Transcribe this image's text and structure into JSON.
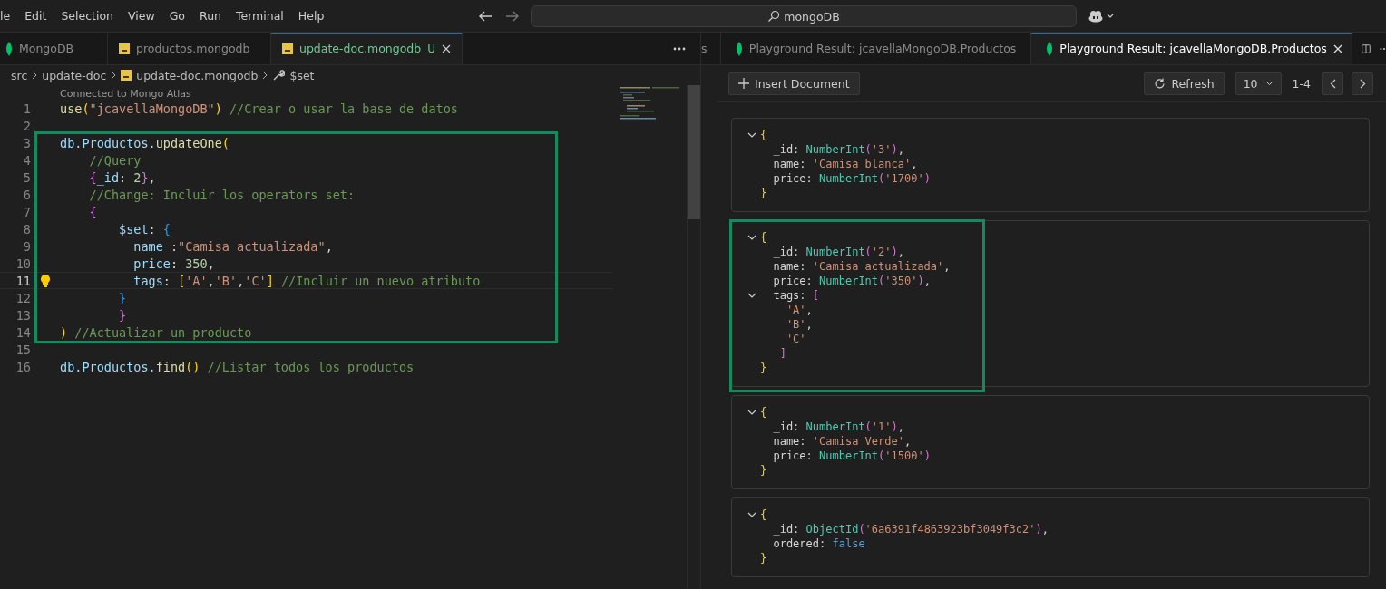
{
  "menu": [
    "le",
    "Edit",
    "Selection",
    "View",
    "Go",
    "Run",
    "Terminal",
    "Help"
  ],
  "search": {
    "value": "mongoDB"
  },
  "editor": {
    "tabs": [
      {
        "label": "MongoDB",
        "kind": "mongo",
        "selected": false
      },
      {
        "label": "productos.mongodb",
        "kind": "js",
        "selected": false
      },
      {
        "label": "update-doc.mongodb",
        "kind": "js",
        "selected": true,
        "badge": "U"
      }
    ],
    "breadcrumb": [
      {
        "label": "src",
        "kind": "folder"
      },
      {
        "label": "update-doc",
        "kind": "folder"
      },
      {
        "label": "update-doc.mongodb",
        "kind": "file"
      },
      {
        "label": "$set",
        "kind": "symbol"
      }
    ],
    "codelens": "Connected to Mongo Atlas",
    "segments": [
      {
        "highlighted": false,
        "lines": [
          {
            "number": "1",
            "current": false,
            "tokens": [
              {
                "text": "use",
                "kind": "fn"
              },
              {
                "text": "(",
                "kind": "b1"
              },
              {
                "text": "\"jcavellaMongoDB\"",
                "kind": "str"
              },
              {
                "text": ")",
                "kind": "b1"
              },
              {
                "text": " //Crear o usar la base de datos",
                "kind": "comment"
              }
            ]
          },
          {
            "number": "2",
            "current": false
          }
        ]
      },
      {
        "highlighted": true,
        "lines": [
          {
            "number": "3",
            "current": false,
            "tokens": [
              {
                "text": "db.Productos.",
                "kind": "var"
              },
              {
                "text": "updateOne",
                "kind": "fn"
              },
              {
                "text": "(",
                "kind": "b1"
              }
            ]
          },
          {
            "number": "4",
            "current": false,
            "tokens": [
              {
                "text": "    //Query",
                "kind": "comment"
              }
            ]
          },
          {
            "number": "5",
            "current": false,
            "tokens": [
              {
                "text": "    {",
                "kind": "b2"
              },
              {
                "text": "_id",
                "kind": "var"
              },
              {
                "text": ": ",
                "kind": "plain"
              },
              {
                "text": "2",
                "kind": "num"
              },
              {
                "text": "}",
                "kind": "b2"
              },
              {
                "text": ",",
                "kind": "plain"
              }
            ]
          },
          {
            "number": "6",
            "current": false,
            "tokens": [
              {
                "text": "    //Change: Incluir los operators set:",
                "kind": "comment"
              }
            ]
          },
          {
            "number": "7",
            "current": false,
            "tokens": [
              {
                "text": "    {",
                "kind": "b2"
              }
            ]
          },
          {
            "number": "8",
            "current": false,
            "tokens": [
              {
                "text": "        $set",
                "kind": "var"
              },
              {
                "text": ": ",
                "kind": "plain"
              },
              {
                "text": "{",
                "kind": "b3"
              }
            ]
          },
          {
            "number": "9",
            "current": false,
            "tokens": [
              {
                "text": "          name",
                "kind": "var"
              },
              {
                "text": " :",
                "kind": "plain"
              },
              {
                "text": "\"Camisa actualizada\"",
                "kind": "str"
              },
              {
                "text": ",",
                "kind": "plain"
              }
            ]
          },
          {
            "number": "10",
            "current": false,
            "tokens": [
              {
                "text": "          price",
                "kind": "var"
              },
              {
                "text": ": ",
                "kind": "plain"
              },
              {
                "text": "350",
                "kind": "num"
              },
              {
                "text": ",",
                "kind": "plain"
              }
            ]
          },
          {
            "number": "11",
            "current": true,
            "tokens": [
              {
                "text": "          tags",
                "kind": "var"
              },
              {
                "text": ": ",
                "kind": "plain"
              },
              {
                "text": "[",
                "kind": "b1"
              },
              {
                "text": "'A'",
                "kind": "str"
              },
              {
                "text": ",",
                "kind": "plain"
              },
              {
                "text": "'B'",
                "kind": "str"
              },
              {
                "text": ",",
                "kind": "plain"
              },
              {
                "text": "'C'",
                "kind": "str"
              },
              {
                "text": "]",
                "kind": "b1"
              },
              {
                "text": " //Incluir un nuevo atributo",
                "kind": "comment"
              }
            ]
          },
          {
            "number": "12",
            "current": false,
            "tokens": [
              {
                "text": "        }",
                "kind": "b3"
              }
            ]
          },
          {
            "number": "13",
            "current": false,
            "tokens": [
              {
                "text": "        }",
                "kind": "b2"
              }
            ]
          },
          {
            "number": "14",
            "current": false,
            "tokens": [
              {
                "text": ")",
                "kind": "b1"
              },
              {
                "text": " //Actualizar un producto",
                "kind": "comment"
              }
            ]
          }
        ]
      },
      {
        "highlighted": false,
        "lines": [
          {
            "number": "15",
            "current": false
          },
          {
            "number": "16",
            "current": false,
            "tokens": [
              {
                "text": "db.Productos.",
                "kind": "var"
              },
              {
                "text": "find",
                "kind": "fn"
              },
              {
                "text": "()",
                "kind": "b1"
              },
              {
                "text": " //Listar todos los productos",
                "kind": "comment"
              }
            ]
          }
        ]
      }
    ]
  },
  "results": {
    "tabs": [
      {
        "label": "s",
        "selected": false,
        "partial": true
      },
      {
        "label": "Playground Result: jcavellaMongoDB.Productos",
        "selected": false,
        "partial": false
      },
      {
        "label": "Playground Result: jcavellaMongoDB.Productos",
        "selected": true,
        "partial": false
      }
    ],
    "insert_button": "Insert Document",
    "refresh_button": "Refresh",
    "page_size": "10",
    "range": "1-4",
    "documents": [
      {
        "highlighted": false,
        "lines": [
          {
            "caret": true,
            "tokens": [
              {
                "text": "{",
                "kind": "b1"
              }
            ]
          },
          {
            "caret": false,
            "tokens": [
              {
                "text": "  _id: ",
                "kind": "plain"
              },
              {
                "text": "NumberInt",
                "kind": "type"
              },
              {
                "text": "(",
                "kind": "b2"
              },
              {
                "text": "'3'",
                "kind": "str"
              },
              {
                "text": ")",
                "kind": "b2"
              },
              {
                "text": ",",
                "kind": "plain"
              }
            ]
          },
          {
            "caret": false,
            "tokens": [
              {
                "text": "  name: ",
                "kind": "plain"
              },
              {
                "text": "'Camisa blanca'",
                "kind": "str"
              },
              {
                "text": ",",
                "kind": "plain"
              }
            ]
          },
          {
            "caret": false,
            "tokens": [
              {
                "text": "  price: ",
                "kind": "plain"
              },
              {
                "text": "NumberInt",
                "kind": "type"
              },
              {
                "text": "(",
                "kind": "b2"
              },
              {
                "text": "'1700'",
                "kind": "str"
              },
              {
                "text": ")",
                "kind": "b2"
              }
            ]
          },
          {
            "caret": false,
            "tokens": [
              {
                "text": "}",
                "kind": "b1"
              }
            ]
          }
        ]
      },
      {
        "highlighted": true,
        "lines": [
          {
            "caret": true,
            "tokens": [
              {
                "text": "{",
                "kind": "b1"
              }
            ]
          },
          {
            "caret": false,
            "tokens": [
              {
                "text": "  _id: ",
                "kind": "plain"
              },
              {
                "text": "NumberInt",
                "kind": "type"
              },
              {
                "text": "(",
                "kind": "b2"
              },
              {
                "text": "'2'",
                "kind": "str"
              },
              {
                "text": ")",
                "kind": "b2"
              },
              {
                "text": ",",
                "kind": "plain"
              }
            ]
          },
          {
            "caret": false,
            "tokens": [
              {
                "text": "  name: ",
                "kind": "plain"
              },
              {
                "text": "'Camisa actualizada'",
                "kind": "str"
              },
              {
                "text": ",",
                "kind": "plain"
              }
            ]
          },
          {
            "caret": false,
            "tokens": [
              {
                "text": "  price: ",
                "kind": "plain"
              },
              {
                "text": "NumberInt",
                "kind": "type"
              },
              {
                "text": "(",
                "kind": "b2"
              },
              {
                "text": "'350'",
                "kind": "str"
              },
              {
                "text": ")",
                "kind": "b2"
              },
              {
                "text": ",",
                "kind": "plain"
              }
            ]
          },
          {
            "caret": true,
            "tokens": [
              {
                "text": "  tags: ",
                "kind": "plain"
              },
              {
                "text": "[",
                "kind": "b2"
              }
            ]
          },
          {
            "caret": false,
            "tokens": [
              {
                "text": "    'A'",
                "kind": "str"
              },
              {
                "text": ",",
                "kind": "plain"
              }
            ]
          },
          {
            "caret": false,
            "tokens": [
              {
                "text": "    'B'",
                "kind": "str"
              },
              {
                "text": ",",
                "kind": "plain"
              }
            ]
          },
          {
            "caret": false,
            "tokens": [
              {
                "text": "    'C'",
                "kind": "str"
              }
            ]
          },
          {
            "caret": false,
            "tokens": [
              {
                "text": "   ]",
                "kind": "b2"
              }
            ]
          },
          {
            "caret": false,
            "tokens": [
              {
                "text": "}",
                "kind": "b1"
              }
            ]
          }
        ]
      },
      {
        "highlighted": false,
        "lines": [
          {
            "caret": true,
            "tokens": [
              {
                "text": "{",
                "kind": "b1"
              }
            ]
          },
          {
            "caret": false,
            "tokens": [
              {
                "text": "  _id: ",
                "kind": "plain"
              },
              {
                "text": "NumberInt",
                "kind": "type"
              },
              {
                "text": "(",
                "kind": "b2"
              },
              {
                "text": "'1'",
                "kind": "str"
              },
              {
                "text": ")",
                "kind": "b2"
              },
              {
                "text": ",",
                "kind": "plain"
              }
            ]
          },
          {
            "caret": false,
            "tokens": [
              {
                "text": "  name: ",
                "kind": "plain"
              },
              {
                "text": "'Camisa Verde'",
                "kind": "str"
              },
              {
                "text": ",",
                "kind": "plain"
              }
            ]
          },
          {
            "caret": false,
            "tokens": [
              {
                "text": "  price: ",
                "kind": "plain"
              },
              {
                "text": "NumberInt",
                "kind": "type"
              },
              {
                "text": "(",
                "kind": "b2"
              },
              {
                "text": "'1500'",
                "kind": "str"
              },
              {
                "text": ")",
                "kind": "b2"
              }
            ]
          },
          {
            "caret": false,
            "tokens": [
              {
                "text": "}",
                "kind": "b1"
              }
            ]
          }
        ]
      },
      {
        "highlighted": false,
        "lines": [
          {
            "caret": true,
            "tokens": [
              {
                "text": "{",
                "kind": "b1"
              }
            ]
          },
          {
            "caret": false,
            "tokens": [
              {
                "text": "  _id: ",
                "kind": "plain"
              },
              {
                "text": "ObjectId",
                "kind": "type"
              },
              {
                "text": "(",
                "kind": "b2"
              },
              {
                "text": "'6a6391f4863923bf3049f3c2'",
                "kind": "str"
              },
              {
                "text": ")",
                "kind": "b2"
              },
              {
                "text": ",",
                "kind": "plain"
              }
            ]
          },
          {
            "caret": false,
            "tokens": [
              {
                "text": "  ordered: ",
                "kind": "plain"
              },
              {
                "text": "false",
                "kind": "bool"
              }
            ]
          },
          {
            "caret": false,
            "tokens": [
              {
                "text": "}",
                "kind": "b1"
              }
            ]
          }
        ]
      }
    ]
  }
}
